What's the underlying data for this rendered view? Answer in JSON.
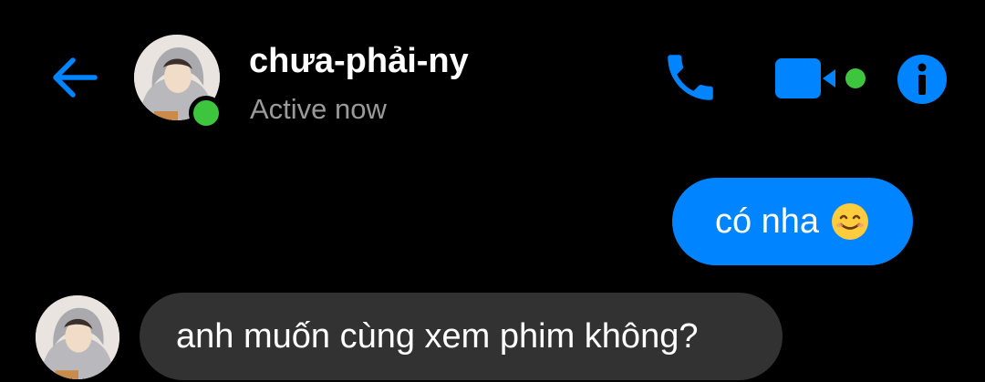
{
  "header": {
    "back_icon": "arrow-left-icon",
    "contact_name": "chưa-phải-ny",
    "status": "Active now",
    "actions": {
      "call_icon": "phone-icon",
      "video_icon": "video-camera-icon",
      "info_icon": "info-icon"
    }
  },
  "messages": [
    {
      "direction": "outgoing",
      "text": "có nha",
      "emoji": "smiling-face-icon"
    },
    {
      "direction": "incoming",
      "text": "anh muốn cùng xem phim không?"
    }
  ],
  "colors": {
    "background": "#000000",
    "accent": "#0084ff",
    "presence_green": "#3ec53e",
    "incoming_bubble": "#323232",
    "status_text": "#9a9a9a"
  }
}
